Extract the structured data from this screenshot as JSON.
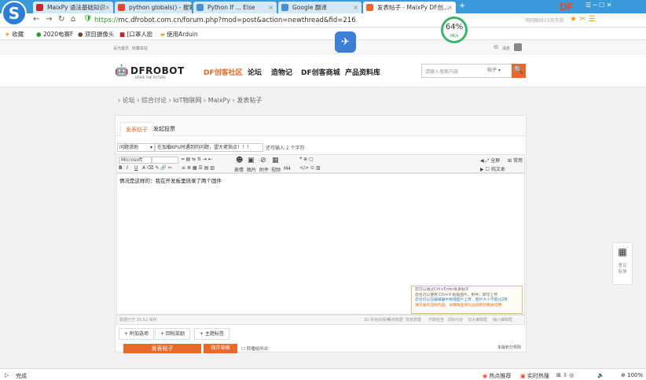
{
  "browser": {
    "tabs": [
      {
        "title": "MaixPy 语法基础知识"
      },
      {
        "title": "python globals() - 搜索"
      },
      {
        "title": "Python If ... Else"
      },
      {
        "title": "Google 翻译"
      },
      {
        "title": "发表帖子 - MaixPy DF创..."
      }
    ],
    "url_scheme": "https://",
    "url_rest": "mc.dfrobot.com.cn/forum.php?mod=post&action=newthread&fid=216",
    "search_hint": "明网眼线15天失败",
    "gauge_percent": "64%",
    "gauge_speed": "0K/s",
    "bookmarks": [
      {
        "label": "收藏"
      },
      {
        "label": "2020电赛F"
      },
      {
        "label": "双目摄像头"
      },
      {
        "label": "[口罩人脸"
      },
      {
        "label": "使用Arduin"
      }
    ],
    "topright_brand": "DF",
    "status_left": "完成",
    "status_items": {
      "hot": "热点推荐",
      "hotwords": "实时热搜",
      "zoom": "100%"
    }
  },
  "site": {
    "top_links": {
      "home": "设为首页",
      "bookmark": "收藏本站"
    },
    "user_label": "消息",
    "brand": "DFROBOT",
    "brand_sub": "DRIVE THE FUTURE",
    "nav": [
      "DF创客社区",
      "论坛",
      "造物记",
      "DF创客商城",
      "产品资料库"
    ],
    "search_placeholder": "请输入搜索内容",
    "search_type": "帖子",
    "search_button": "🔍"
  },
  "breadcrumb": "› 论坛 › 综合讨论 › IoT物联网 › MaixPy › 发表帖子",
  "composer": {
    "tabs": [
      "发表帖子",
      "发起投票"
    ],
    "category": "问题求助",
    "title_value": "在加载KPU时遇到的问题，望大佬指点！！！ ",
    "title_count": "还可输入 2 个字符",
    "font_name": "Microsoft",
    "toolbar_right": {
      "fullscreen": "全屏",
      "common": "常用",
      "plaintext": "纯文本"
    },
    "toolbar_big": [
      "表情",
      "图片",
      "附件",
      "视频",
      "M4"
    ],
    "body_text": "情况是这样的：我在开发板里烧录了两个固件",
    "hint_lines": [
      "您可以通过Ctrl+Enter发表帖子",
      "您也可以使用 Ctrl+V 粘贴图片、附件，即可上传",
      "您也可以在编辑器中拖拽图片上传，图片大小不超过2M",
      "请勿发布违规内容，详细请查阅论坛规则的相关说明"
    ],
    "status_left": "数据已于 15:52 保存",
    "status_right": [
      "30 秒自动保存",
      "保存数据",
      "恢复数据",
      "字数检查",
      "清除内容",
      "加大编辑框",
      "缩小编辑框"
    ],
    "options": [
      "附加选项",
      "回帖奖励",
      "主题标签"
    ],
    "submit": "发表帖子",
    "save_draft": "保存草稿",
    "convert": "转播给听众",
    "rules": "本版积分规则"
  },
  "side_float": {
    "label1": "意见",
    "label2": "反馈"
  }
}
